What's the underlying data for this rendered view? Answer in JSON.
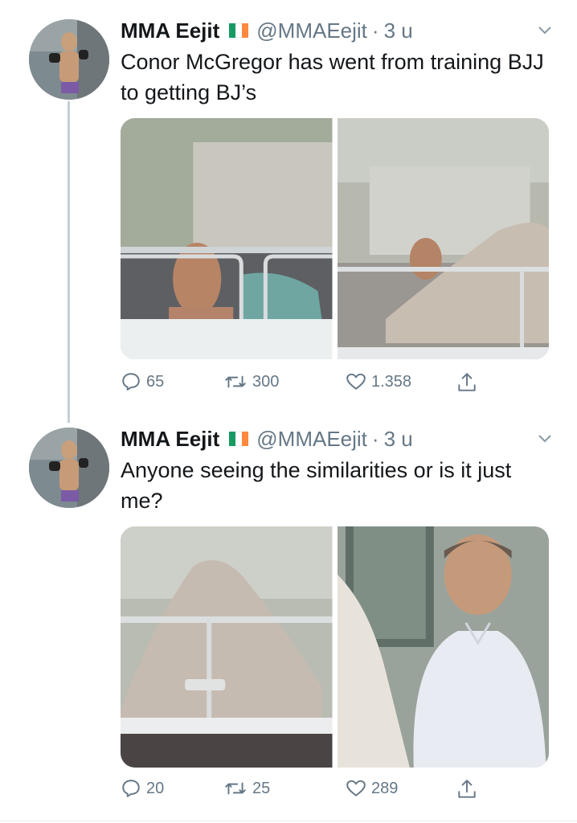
{
  "tweets": [
    {
      "name": "MMA Eejit",
      "handle": "@MMAEejit",
      "dot": "·",
      "time": "3 u",
      "text": "Conor McGregor has went from training BJJ to getting BJ’s",
      "replies": "65",
      "retweets": "300",
      "likes": "1.358"
    },
    {
      "name": "MMA Eejit",
      "handle": "@MMAEejit",
      "dot": "·",
      "time": "3 u",
      "text": "Anyone seeing the similarities or is it just me?",
      "replies": "20",
      "retweets": "25",
      "likes": "289"
    }
  ],
  "icons": {
    "reply": "reply-icon",
    "retweet": "retweet-icon",
    "like": "heart-icon",
    "share": "share-icon",
    "caret": "chevron-down-icon",
    "flag": "ireland-flag-icon"
  },
  "colors": {
    "text": "#14171a",
    "muted": "#657786",
    "thread_line": "#c4cfd6",
    "flag_green": "#169b62",
    "flag_white": "#ffffff",
    "flag_orange": "#ff883e"
  }
}
